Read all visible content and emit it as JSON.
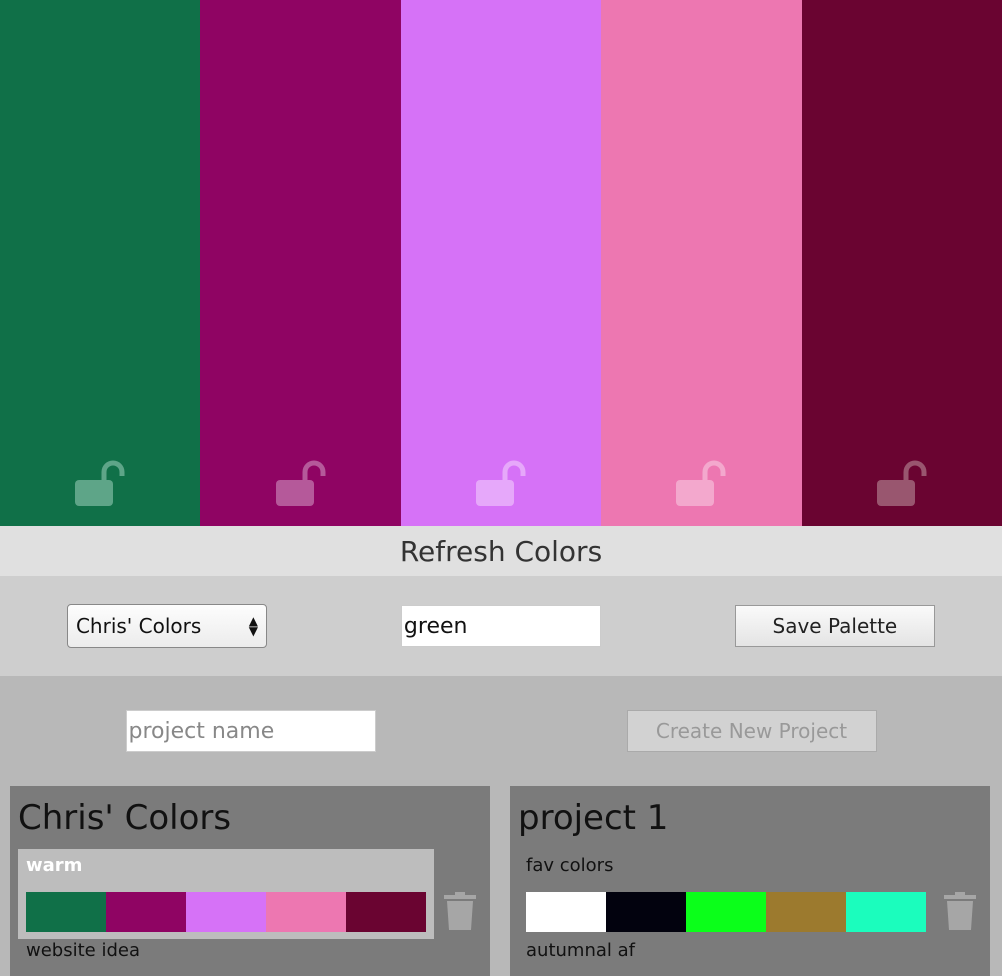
{
  "swatches": [
    {
      "color": "#107048",
      "lock_color": "#5ea588"
    },
    {
      "color": "#8f0463",
      "lock_color": "#b5599a"
    },
    {
      "color": "#d672f7",
      "lock_color": "#e6a8fa"
    },
    {
      "color": "#ed77b1",
      "lock_color": "#f3a8cd"
    },
    {
      "color": "#6a0431",
      "lock_color": "#99566f"
    }
  ],
  "refresh_label": "Refresh Colors",
  "controls": {
    "project_select": "Chris' Colors",
    "palette_name_value": "green",
    "save_label": "Save Palette"
  },
  "new_project": {
    "placeholder": "project name",
    "create_label": "Create New Project"
  },
  "projects": [
    {
      "title": "Chris' Colors",
      "palette_name": "warm",
      "colors": [
        "#107048",
        "#8f0463",
        "#d672f7",
        "#ed77b1",
        "#6a0431"
      ],
      "next_palette": "website idea"
    },
    {
      "title": "project 1",
      "palette_name": "fav colors",
      "colors": [
        "#ffffff",
        "#02020e",
        "#0bff1a",
        "#9c7a2e",
        "#1bfdbd"
      ],
      "next_palette": "autumnal af"
    }
  ],
  "icons": {
    "lock": "unlocked-lock-icon",
    "trash": "trash-icon"
  }
}
